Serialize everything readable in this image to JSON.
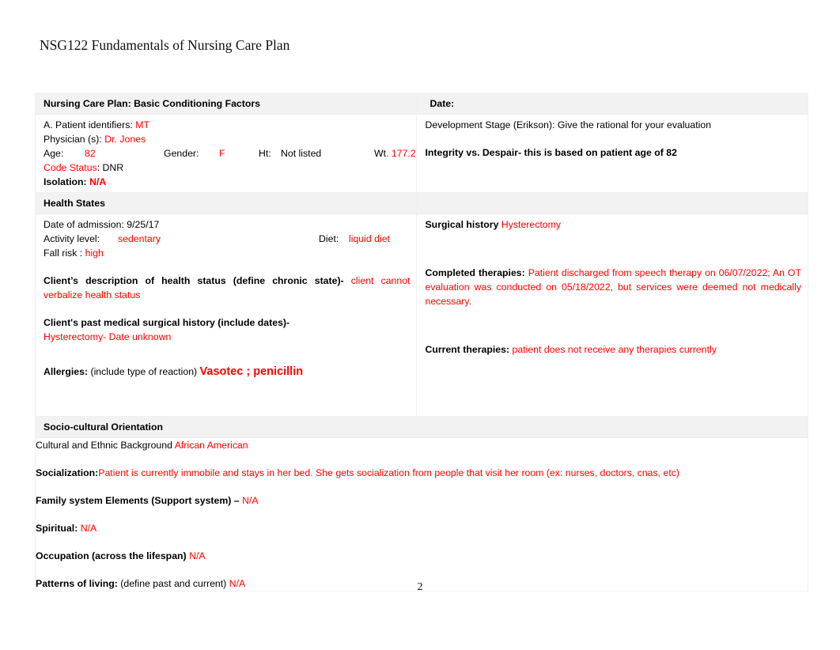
{
  "document": {
    "heading": "NSG122 Fundamentals of Nursing Care Plan",
    "page_number": "2"
  },
  "table": {
    "row_basic_conditioning": {
      "left_header": "Nursing Care Plan: Basic Conditioning Factors",
      "right_header": "Date:",
      "patient_identifiers_label": "A. Patient identifiers:",
      "patient_identifiers_value": "MT",
      "physician_label": "Physician (s):",
      "physician_value": "Dr. Jones",
      "age_label": "Age:",
      "age_value": "82",
      "gender_label": "Gender:",
      "gender_value": "F",
      "height_label": "Ht:",
      "height_value": "Not listed",
      "weight_label": "Wt",
      "weight_value": ". 177.2",
      "code_status_label": "Code Status",
      "code_status_value": ": DNR",
      "isolation_label": "Isolation:",
      "isolation_value": "N/A",
      "development_stage_prompt": "Development Stage (Erikson): Give the rational for your evaluation",
      "development_stage_answer": "Integrity vs. Despair- this is based on patient age of 82"
    },
    "row_health_states": {
      "left_header": "Health States",
      "admission_label": "Date of admission:",
      "admission_value": "9/25/17",
      "activity_label": "Activity level:",
      "activity_value": "sedentary",
      "diet_label": "Diet:",
      "diet_value": "liquid diet",
      "fall_risk_label": "Fall risk :",
      "fall_risk_value": "high",
      "health_status_label": "Client’s description of health status (define chronic state)-",
      "health_status_value": "client cannot verbalize health status",
      "past_history_label": "Client's past medical surgical history (include dates)-",
      "past_history_value": "Hysterectomy- Date unknown",
      "allergies_label": "Allergies:",
      "allergies_note": "(include type of reaction)",
      "allergies_value": "Vasotec ; penicillin",
      "surgical_history_label": "Surgical history",
      "surgical_history_value": "Hysterectomy",
      "completed_therapies_label": "Completed therapies:",
      "completed_therapies_value": "Patient discharged from speech therapy on 06/07/2022; An OT evaluation was conducted on 05/18/2022, but services were deemed not medically necessary.",
      "current_therapies_label": "Current therapies:",
      "current_therapies_value": "patient does not receive any therapies currently"
    },
    "row_socio_cultural": {
      "header": "Socio-cultural Orientation",
      "cultural_label": "Cultural and Ethnic Background",
      "cultural_value": "African American",
      "socialization_label": "Socialization:",
      "socialization_value": "Patient is currently immobile and stays in her bed. She gets socialization from people that visit her room (ex: nurses, doctors, cnas, etc)",
      "family_label": "Family system Elements (Support system) –",
      "family_value": "N/A",
      "spiritual_label": "Spiritual:",
      "spiritual_value": "N/A",
      "occupation_label": "Occupation (across the lifespan)",
      "occupation_value": "N/A",
      "patterns_label": "Patterns of living:",
      "patterns_note": "(define past and current)",
      "patterns_value": "N/A"
    }
  },
  "colors": {
    "entry_red": "#ff0000",
    "text_black": "#000000",
    "row_shade": "#f2f2f2"
  }
}
